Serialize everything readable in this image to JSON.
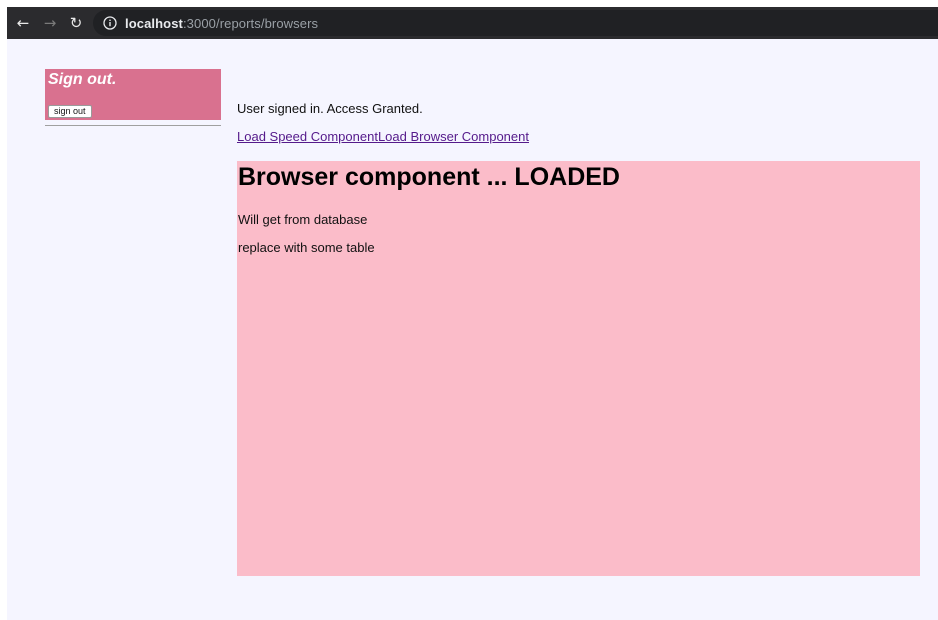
{
  "browser": {
    "url_host": "localhost",
    "url_path": ":3000/reports/browsers",
    "icons": {
      "back": "back-arrow-icon",
      "forward": "forward-arrow-icon",
      "reload": "reload-icon",
      "info": "info-icon"
    }
  },
  "signout": {
    "heading": "Sign out.",
    "button_label": "sign out"
  },
  "status": "User signed in. Access Granted.",
  "links": {
    "speed": "Load Speed Component",
    "browser": "Load Browser Component"
  },
  "component": {
    "title": "Browser component ... LOADED",
    "line1": "Will get from database",
    "line2": "replace with some table"
  },
  "colors": {
    "signout_bg": "#d9718f",
    "component_bg": "#fbbcc9",
    "page_bg": "#f5f5ff",
    "link": "#551a8b"
  }
}
